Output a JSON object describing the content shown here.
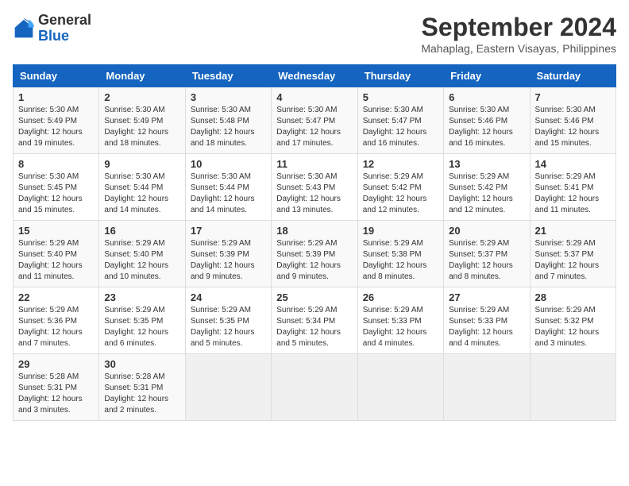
{
  "header": {
    "logo_general": "General",
    "logo_blue": "Blue",
    "month_year": "September 2024",
    "location": "Mahaplag, Eastern Visayas, Philippines"
  },
  "columns": [
    "Sunday",
    "Monday",
    "Tuesday",
    "Wednesday",
    "Thursday",
    "Friday",
    "Saturday"
  ],
  "weeks": [
    [
      {
        "day": "1",
        "sunrise": "Sunrise: 5:30 AM",
        "sunset": "Sunset: 5:49 PM",
        "daylight": "Daylight: 12 hours and 19 minutes."
      },
      {
        "day": "2",
        "sunrise": "Sunrise: 5:30 AM",
        "sunset": "Sunset: 5:49 PM",
        "daylight": "Daylight: 12 hours and 18 minutes."
      },
      {
        "day": "3",
        "sunrise": "Sunrise: 5:30 AM",
        "sunset": "Sunset: 5:48 PM",
        "daylight": "Daylight: 12 hours and 18 minutes."
      },
      {
        "day": "4",
        "sunrise": "Sunrise: 5:30 AM",
        "sunset": "Sunset: 5:47 PM",
        "daylight": "Daylight: 12 hours and 17 minutes."
      },
      {
        "day": "5",
        "sunrise": "Sunrise: 5:30 AM",
        "sunset": "Sunset: 5:47 PM",
        "daylight": "Daylight: 12 hours and 16 minutes."
      },
      {
        "day": "6",
        "sunrise": "Sunrise: 5:30 AM",
        "sunset": "Sunset: 5:46 PM",
        "daylight": "Daylight: 12 hours and 16 minutes."
      },
      {
        "day": "7",
        "sunrise": "Sunrise: 5:30 AM",
        "sunset": "Sunset: 5:46 PM",
        "daylight": "Daylight: 12 hours and 15 minutes."
      }
    ],
    [
      {
        "day": "8",
        "sunrise": "Sunrise: 5:30 AM",
        "sunset": "Sunset: 5:45 PM",
        "daylight": "Daylight: 12 hours and 15 minutes."
      },
      {
        "day": "9",
        "sunrise": "Sunrise: 5:30 AM",
        "sunset": "Sunset: 5:44 PM",
        "daylight": "Daylight: 12 hours and 14 minutes."
      },
      {
        "day": "10",
        "sunrise": "Sunrise: 5:30 AM",
        "sunset": "Sunset: 5:44 PM",
        "daylight": "Daylight: 12 hours and 14 minutes."
      },
      {
        "day": "11",
        "sunrise": "Sunrise: 5:30 AM",
        "sunset": "Sunset: 5:43 PM",
        "daylight": "Daylight: 12 hours and 13 minutes."
      },
      {
        "day": "12",
        "sunrise": "Sunrise: 5:29 AM",
        "sunset": "Sunset: 5:42 PM",
        "daylight": "Daylight: 12 hours and 12 minutes."
      },
      {
        "day": "13",
        "sunrise": "Sunrise: 5:29 AM",
        "sunset": "Sunset: 5:42 PM",
        "daylight": "Daylight: 12 hours and 12 minutes."
      },
      {
        "day": "14",
        "sunrise": "Sunrise: 5:29 AM",
        "sunset": "Sunset: 5:41 PM",
        "daylight": "Daylight: 12 hours and 11 minutes."
      }
    ],
    [
      {
        "day": "15",
        "sunrise": "Sunrise: 5:29 AM",
        "sunset": "Sunset: 5:40 PM",
        "daylight": "Daylight: 12 hours and 11 minutes."
      },
      {
        "day": "16",
        "sunrise": "Sunrise: 5:29 AM",
        "sunset": "Sunset: 5:40 PM",
        "daylight": "Daylight: 12 hours and 10 minutes."
      },
      {
        "day": "17",
        "sunrise": "Sunrise: 5:29 AM",
        "sunset": "Sunset: 5:39 PM",
        "daylight": "Daylight: 12 hours and 9 minutes."
      },
      {
        "day": "18",
        "sunrise": "Sunrise: 5:29 AM",
        "sunset": "Sunset: 5:39 PM",
        "daylight": "Daylight: 12 hours and 9 minutes."
      },
      {
        "day": "19",
        "sunrise": "Sunrise: 5:29 AM",
        "sunset": "Sunset: 5:38 PM",
        "daylight": "Daylight: 12 hours and 8 minutes."
      },
      {
        "day": "20",
        "sunrise": "Sunrise: 5:29 AM",
        "sunset": "Sunset: 5:37 PM",
        "daylight": "Daylight: 12 hours and 8 minutes."
      },
      {
        "day": "21",
        "sunrise": "Sunrise: 5:29 AM",
        "sunset": "Sunset: 5:37 PM",
        "daylight": "Daylight: 12 hours and 7 minutes."
      }
    ],
    [
      {
        "day": "22",
        "sunrise": "Sunrise: 5:29 AM",
        "sunset": "Sunset: 5:36 PM",
        "daylight": "Daylight: 12 hours and 7 minutes."
      },
      {
        "day": "23",
        "sunrise": "Sunrise: 5:29 AM",
        "sunset": "Sunset: 5:35 PM",
        "daylight": "Daylight: 12 hours and 6 minutes."
      },
      {
        "day": "24",
        "sunrise": "Sunrise: 5:29 AM",
        "sunset": "Sunset: 5:35 PM",
        "daylight": "Daylight: 12 hours and 5 minutes."
      },
      {
        "day": "25",
        "sunrise": "Sunrise: 5:29 AM",
        "sunset": "Sunset: 5:34 PM",
        "daylight": "Daylight: 12 hours and 5 minutes."
      },
      {
        "day": "26",
        "sunrise": "Sunrise: 5:29 AM",
        "sunset": "Sunset: 5:33 PM",
        "daylight": "Daylight: 12 hours and 4 minutes."
      },
      {
        "day": "27",
        "sunrise": "Sunrise: 5:29 AM",
        "sunset": "Sunset: 5:33 PM",
        "daylight": "Daylight: 12 hours and 4 minutes."
      },
      {
        "day": "28",
        "sunrise": "Sunrise: 5:29 AM",
        "sunset": "Sunset: 5:32 PM",
        "daylight": "Daylight: 12 hours and 3 minutes."
      }
    ],
    [
      {
        "day": "29",
        "sunrise": "Sunrise: 5:28 AM",
        "sunset": "Sunset: 5:31 PM",
        "daylight": "Daylight: 12 hours and 3 minutes."
      },
      {
        "day": "30",
        "sunrise": "Sunrise: 5:28 AM",
        "sunset": "Sunset: 5:31 PM",
        "daylight": "Daylight: 12 hours and 2 minutes."
      },
      null,
      null,
      null,
      null,
      null
    ]
  ]
}
